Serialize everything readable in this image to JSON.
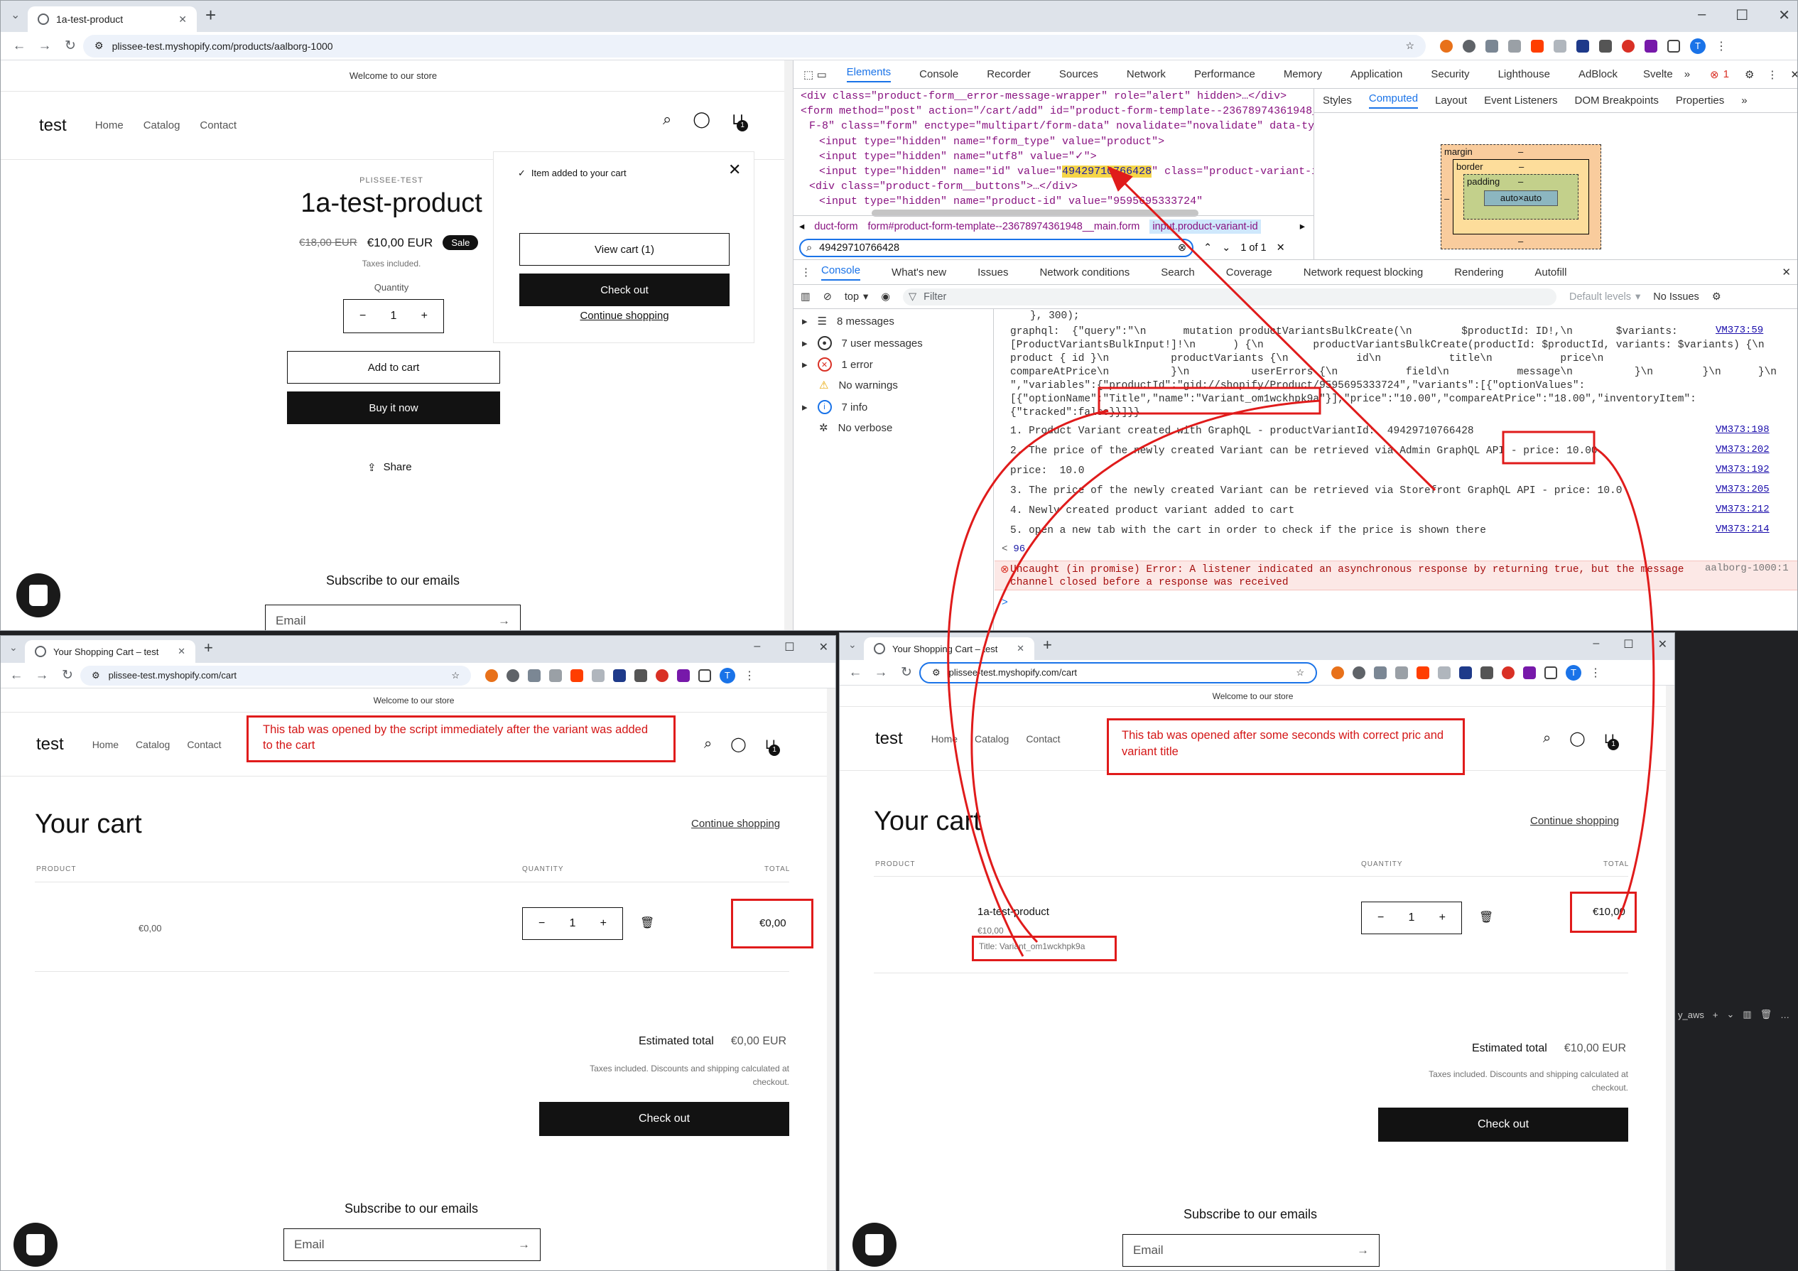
{
  "main": {
    "tab_title": "1a-test-product",
    "url": "plissee-test.myshopify.com/products/aalborg-1000",
    "announcement": "Welcome to our store",
    "logo": "test",
    "nav": [
      "Home",
      "Catalog",
      "Contact"
    ],
    "cart_count": "1",
    "vendor": "PLISSEE-TEST",
    "product_title": "1a-test-product",
    "compare_price": "€18,00 EUR",
    "price": "€10,00 EUR",
    "sale_badge": "Sale",
    "taxes": "Taxes included.",
    "quantity_label": "Quantity",
    "quantity": "1",
    "add_to_cart": "Add to cart",
    "buy_now": "Buy it now",
    "share": "Share",
    "subscribe": "Subscribe to our emails",
    "email_placeholder": "Email",
    "popup": {
      "added": "Item added to your cart",
      "view_cart": "View cart (1)",
      "checkout": "Check out",
      "continue": "Continue shopping"
    }
  },
  "devtools": {
    "tabs": [
      "Elements",
      "Console",
      "Recorder",
      "Sources",
      "Network",
      "Performance",
      "Memory",
      "Application",
      "Security",
      "Lighthouse",
      "AdBlock",
      "Svelte"
    ],
    "error_count": "1",
    "styles_tabs": [
      "Styles",
      "Computed",
      "Layout",
      "Event Listeners",
      "DOM Breakpoints",
      "Properties"
    ],
    "box": {
      "margin": "margin",
      "border": "border",
      "padding": "padding",
      "content": "auto×auto",
      "dash": "–"
    },
    "html_lines": [
      "<div class=\"product-form__error-message-wrapper\" role=\"alert\" hidden>…</div>",
      "<form method=\"post\" action=\"/cart/add\" id=\"product-form-template--23678974361948__ma",
      "F-8\" class=\"form\" enctype=\"multipart/form-data\" novalidate=\"novalidate\" data-type=\"a",
      "<input type=\"hidden\" name=\"form_type\" value=\"product\">",
      "<input type=\"hidden\" name=\"utf8\" value=\"✓\">",
      "<input type=\"hidden\" name=\"id\" value=\"",
      "<div class=\"product-form__buttons\">…</div>",
      "<input type=\"hidden\" name=\"product-id\" value=\"9595695333724\""
    ],
    "highlight_id": "49429710766428",
    "id_line_tail": "\" class=\"product-variant-id\"> ",
    "breadcrumbs": [
      "duct-form",
      "form#product-form-template--23678974361948__main.form",
      "input.product-variant-id"
    ],
    "search_value": "49429710766428",
    "search_count": "1 of 1",
    "drawer_tabs": [
      "Console",
      "What's new",
      "Issues",
      "Network conditions",
      "Search",
      "Coverage",
      "Network request blocking",
      "Rendering",
      "Autofill"
    ],
    "context": "top",
    "filter_placeholder": "Filter",
    "levels": "Default levels",
    "issues": "No Issues",
    "sidebar": [
      "8 messages",
      "7 user messages",
      "1 error",
      "No warnings",
      "7 info",
      "No verbose"
    ],
    "console_lines": [
      "}, 300);",
      "graphql:  {\"query\":\"\\n      mutation productVariantsBulkCreate(\\n        $productId: ID!,\\n       $variants:",
      "[ProductVariantsBulkInput!]!\\n      ) {\\n        productVariantsBulkCreate(productId: $productId, variants: $variants) {\\n",
      "product { id }\\n          productVariants {\\n           id\\n           title\\n           price\\n",
      "compareAtPrice\\n          }\\n          userErrors {\\n           field\\n           message\\n          }\\n        }\\n      }\\n",
      "\",\"variables\":{\"productId\":\"gid://shopify/Product/9595695333724\",\"variants\":[{\"optionValues\":",
      "[{\"optionName\":\"Title\",\"name\":\"Variant_om1wckhpk9a\"}],\"price\":\"10.00\",\"compareAtPrice\":\"18.00\",\"inventoryItem\":",
      "{\"tracked\":false}}]}}",
      "1. Product Variant created with GraphQL - productVariantId:  49429710766428",
      "2. The price of the newly created Variant can be retrieved via Admin GraphQL API - price: 10.00",
      "price:  10.0",
      "3. The price of the newly created Variant can be retrieved via Storefront GraphQL API - price: 10.0",
      "4. Newly created product variant added to cart",
      "5. open a new tab with the cart in order to check if the price is shown there",
      "96",
      "Uncaught (in promise) Error: A listener indicated an asynchronous response by returning true, but the message",
      "channel closed before a response was received"
    ],
    "links": [
      "VM373:59",
      "VM373:198",
      "VM373:202",
      "VM373:192",
      "VM373:205",
      "VM373:212",
      "VM373:214",
      "aalborg-1000:1"
    ],
    "return_arrow": "<",
    "prompt": ">"
  },
  "cart_left": {
    "tab_title": "Your Shopping Cart – test",
    "url": "plissee-test.myshopify.com/cart",
    "announcement": "Welcome to our store",
    "logo": "test",
    "nav": [
      "Home",
      "Catalog",
      "Contact"
    ],
    "note": "This tab was opened by the script immediately after the variant was added to the cart",
    "heading": "Your cart",
    "continue": "Continue shopping",
    "col_product": "PRODUCT",
    "col_quantity": "QUANTITY",
    "col_total": "TOTAL",
    "item_price": "€0,00",
    "quantity": "1",
    "item_total": "€0,00",
    "estimated_label": "Estimated total",
    "estimated_value": "€0,00 EUR",
    "taxes": "Taxes included. Discounts and shipping calculated at checkout.",
    "checkout": "Check out",
    "subscribe": "Subscribe to our emails",
    "email_placeholder": "Email"
  },
  "cart_right": {
    "tab_title": "Your Shopping Cart – test",
    "url": "plissee-test.myshopify.com/cart",
    "announcement": "Welcome to our store",
    "logo": "test",
    "nav": [
      "Home",
      "Catalog",
      "Contact"
    ],
    "note": "This tab was opened after some seconds with correct pric and variant title",
    "heading": "Your cart",
    "continue": "Continue shopping",
    "col_product": "PRODUCT",
    "col_quantity": "QUANTITY",
    "col_total": "TOTAL",
    "item_name": "1a-test-product",
    "item_price": "€10,00",
    "item_variant": "Title: Variant_om1wckhpk9a",
    "quantity": "1",
    "item_total": "€10,00",
    "estimated_label": "Estimated total",
    "estimated_value": "€10,00 EUR",
    "taxes": "Taxes included. Discounts and shipping calculated at checkout.",
    "checkout": "Check out",
    "subscribe": "Subscribe to our emails",
    "email_placeholder": "Email"
  },
  "terminal": {
    "label": "y_aws"
  },
  "colors": {
    "annotation": "#e01b1b",
    "devtools_active": "#1a73e8",
    "button_dark": "#121212",
    "highlight": "#f5d547"
  }
}
